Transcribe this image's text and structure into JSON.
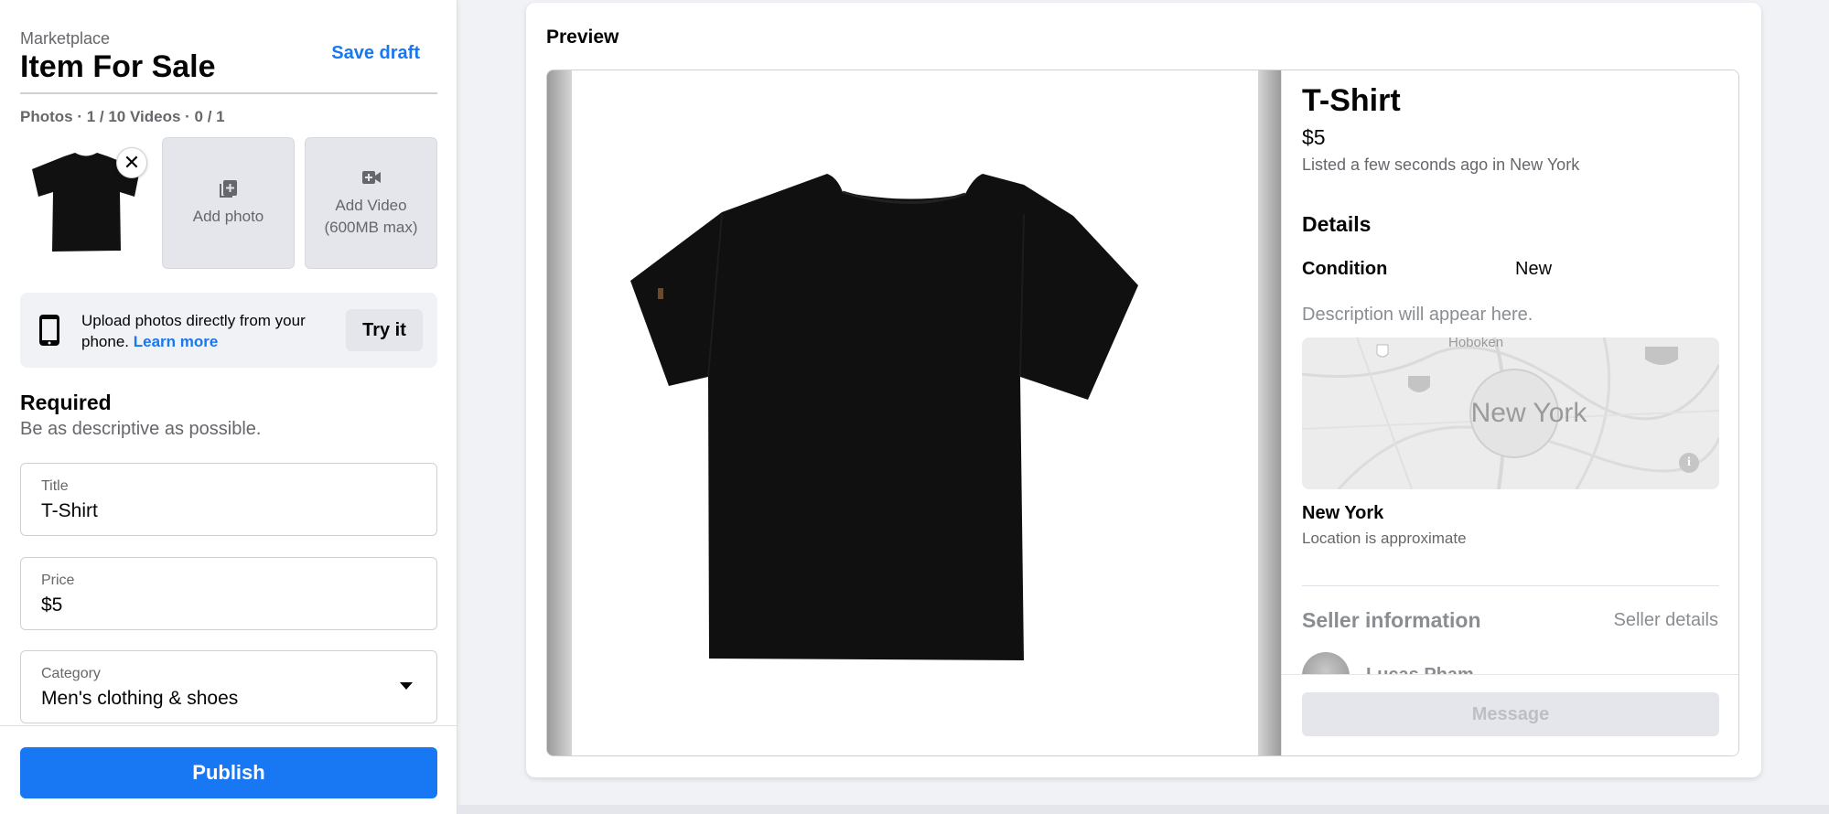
{
  "sidebar": {
    "breadcrumb": "Marketplace",
    "title": "Item For Sale",
    "save_draft": "Save draft",
    "media_count": "Photos · 1 / 10 Videos · 0 / 1",
    "add_photo": "Add photo",
    "add_video": "Add Video",
    "add_video_limit": "(600MB max)",
    "phone_prompt": "Upload photos directly from your phone.",
    "learn_more": "Learn more",
    "try_it": "Try it",
    "required_heading": "Required",
    "required_sub": "Be as descriptive as possible.",
    "fields": {
      "title": {
        "label": "Title",
        "value": "T-Shirt"
      },
      "price": {
        "label": "Price",
        "value": "$5"
      },
      "category": {
        "label": "Category",
        "value": "Men's clothing & shoes"
      }
    },
    "publish": "Publish"
  },
  "preview": {
    "label": "Preview",
    "item_title": "T-Shirt",
    "price": "$5",
    "listed": "Listed a few seconds ago in New York",
    "details_heading": "Details",
    "condition_label": "Condition",
    "condition_value": "New",
    "description_placeholder": "Description will appear here.",
    "map_city": "New York",
    "map_hoboken": "Hoboken",
    "location": "New York",
    "location_sub": "Location is approximate",
    "seller_heading": "Seller information",
    "seller_details": "Seller details",
    "seller_name": "Lucas Pham",
    "message": "Message"
  },
  "colors": {
    "accent": "#1877f2",
    "secondary_text": "#65676b",
    "surface": "#f0f2f5",
    "shirt": "#111111"
  }
}
